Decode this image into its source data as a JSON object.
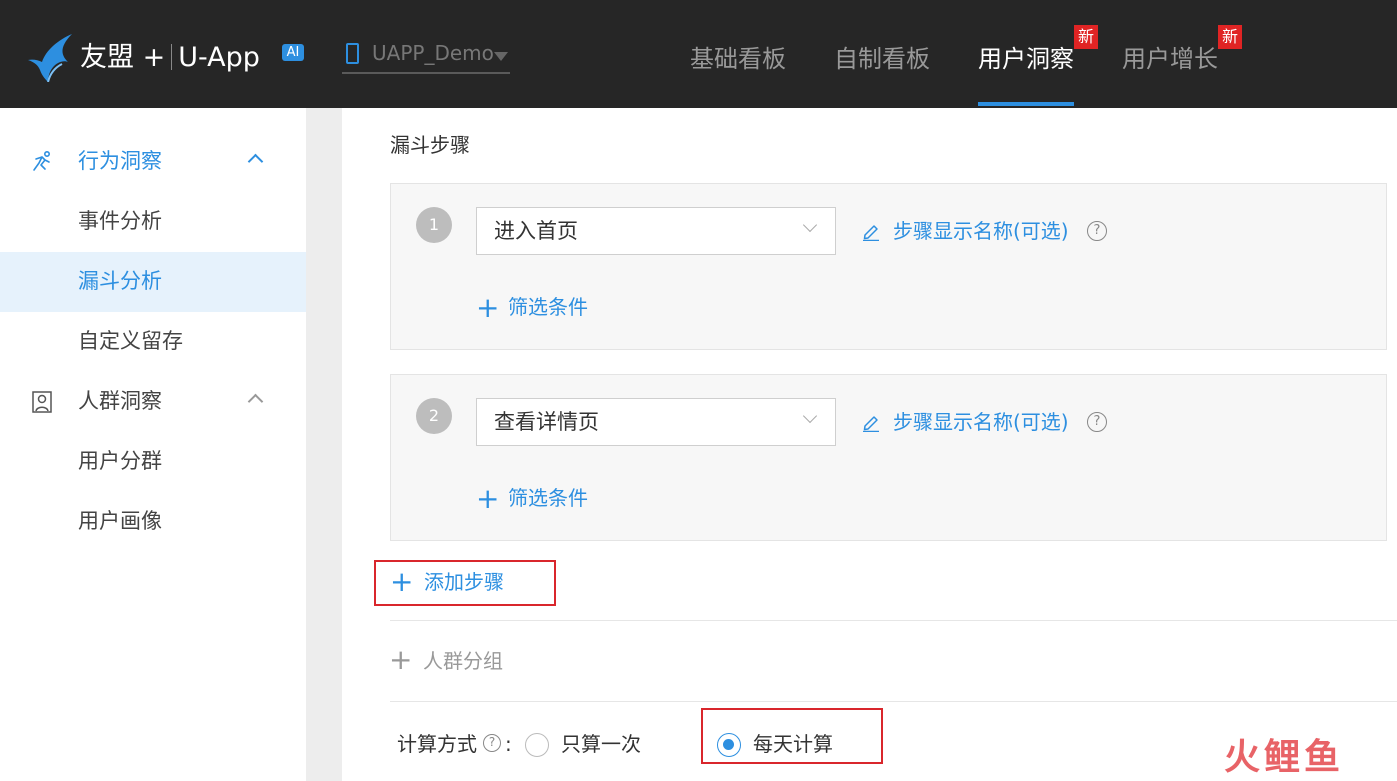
{
  "header": {
    "brand": "友盟 +",
    "product": "U-App",
    "ai_badge": "AI",
    "app_selector": "UAPP_Demo",
    "nav": [
      {
        "label": "基础看板",
        "active": false
      },
      {
        "label": "自制看板",
        "active": false
      },
      {
        "label": "用户洞察",
        "active": true,
        "badge": "新"
      },
      {
        "label": "用户增长",
        "active": false,
        "badge": "新"
      }
    ],
    "accent": "#2d8fe0",
    "badge_color": "#e02424"
  },
  "sidebar": {
    "groups": [
      {
        "label": "行为洞察",
        "icon": "running-person-icon",
        "expanded": true,
        "items": [
          {
            "label": "事件分析",
            "selected": false
          },
          {
            "label": "漏斗分析",
            "selected": true
          },
          {
            "label": "自定义留存",
            "selected": false
          }
        ]
      },
      {
        "label": "人群洞察",
        "icon": "person-portrait-icon",
        "expanded": true,
        "items": [
          {
            "label": "用户分群",
            "selected": false
          },
          {
            "label": "用户画像",
            "selected": false
          }
        ]
      }
    ]
  },
  "funnel": {
    "title": "漏斗步骤",
    "steps": [
      {
        "number": "1",
        "event": "进入首页",
        "display_name_link": "步骤显示名称(可选)",
        "help": "?",
        "filter_label": "筛选条件"
      },
      {
        "number": "2",
        "event": "查看详情页",
        "display_name_link": "步骤显示名称(可选)",
        "help": "?",
        "filter_label": "筛选条件"
      }
    ],
    "add_step": "添加步骤",
    "crowd_group": "人群分组",
    "plus": "+"
  },
  "calculation": {
    "label": "计算方式",
    "help": "?",
    "colon": ":",
    "options": [
      {
        "label": "只算一次",
        "checked": false
      },
      {
        "label": "每天计算",
        "checked": true
      }
    ]
  },
  "watermark": "火鲤鱼"
}
